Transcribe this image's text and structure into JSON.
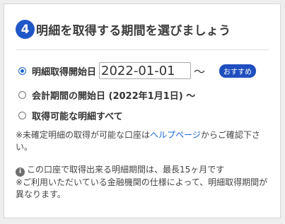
{
  "step": {
    "number": "4",
    "title": "明細を取得する期間を選びましょう"
  },
  "options": [
    {
      "label": "明細取得開始日",
      "checked": true,
      "date_value": "2022-01-01",
      "suffix": "〜",
      "badge": "おすすめ"
    },
    {
      "label": "会計期間の開始日 (2022年1月1日) 〜",
      "checked": false
    },
    {
      "label": "取得可能な明細すべて",
      "checked": false
    }
  ],
  "notes": {
    "unconfirmed_prefix": "※未確定明細の取得が可能な口座は",
    "help_link": "ヘルプページ",
    "unconfirmed_suffix": "からご確認下さい。",
    "info_icon": "info-icon",
    "period_limit": "この口座で取得出来る明細期間は、最長15ヶ月です",
    "institution_note": "※ご利用いただいている金融機関の仕様によって、明細取得期間が異なります。"
  },
  "colors": {
    "accent": "#1f57c7",
    "link": "#1a64d6",
    "badge": "#1f4fbf"
  }
}
